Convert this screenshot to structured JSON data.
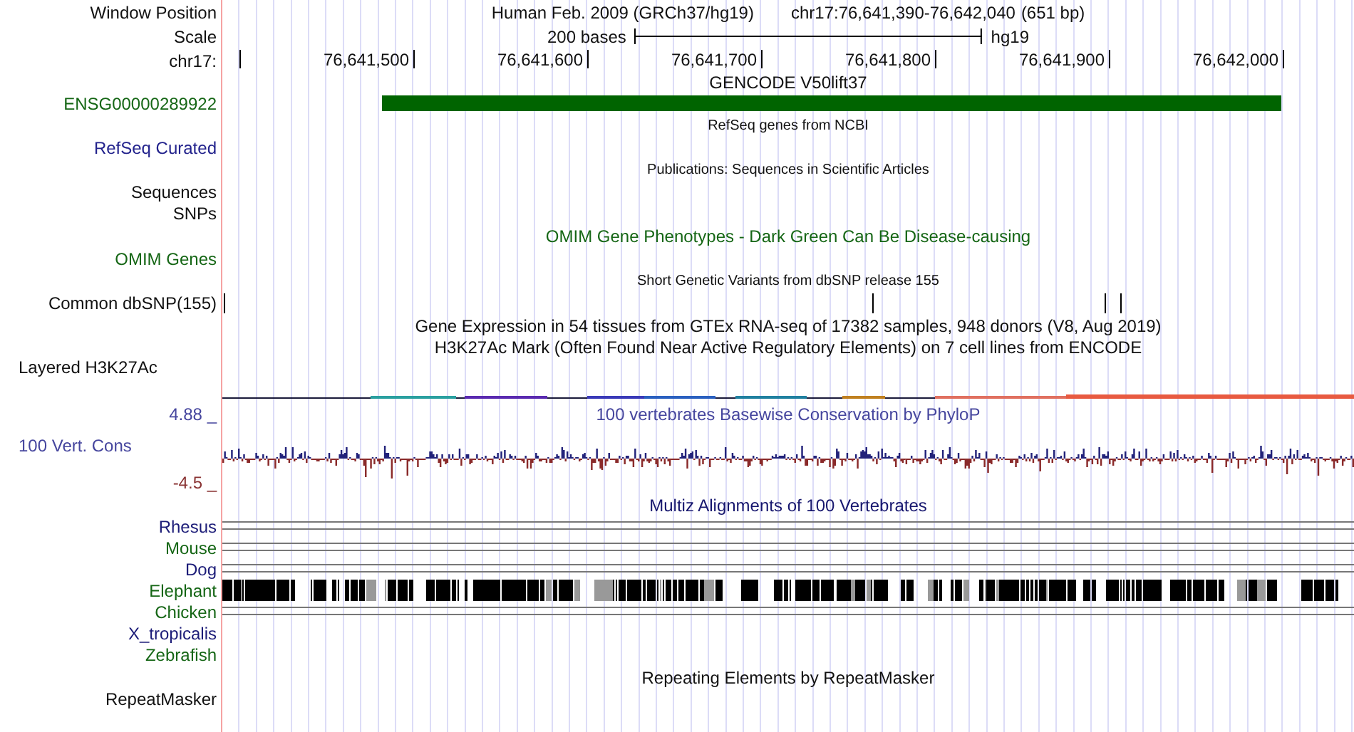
{
  "window_position": {
    "label": "Window Position",
    "assembly": "Human Feb. 2009 (GRCh37/hg19)",
    "position": "chr17:76,641,390-76,642,040",
    "size": "(651 bp)"
  },
  "scale": {
    "label": "Scale",
    "length": "200 bases",
    "assembly": "hg19"
  },
  "ruler": {
    "label": "chr17:",
    "ticks": [
      "76,641,500",
      "76,641,600",
      "76,641,700",
      "76,641,800",
      "76,641,900",
      "76,642,000"
    ]
  },
  "tracks": [
    {
      "kind": "gene",
      "title": "GENCODE V50lift37",
      "label": "ENSG00000289922"
    },
    {
      "kind": "refseq",
      "title": "RefSeq genes from NCBI",
      "label": "RefSeq Curated"
    },
    {
      "kind": "publications",
      "title": "Publications: Sequences in Scientific Articles",
      "labels": [
        "Sequences",
        "SNPs"
      ]
    },
    {
      "kind": "omim",
      "title": "OMIM Gene Phenotypes - Dark Green Can Be Disease-causing",
      "label": "OMIM Genes"
    },
    {
      "kind": "snp",
      "title": "Short Genetic Variants from dbSNP release 155",
      "label": "Common dbSNP(155)"
    },
    {
      "kind": "gtex",
      "title": "Gene Expression in 54 tissues from GTEx RNA-seq of 17382 samples, 948 donors (V8, Aug 2019)"
    },
    {
      "kind": "layered",
      "title": "H3K27Ac Mark (Often Found Near Active Regulatory Elements) on 7 cell lines from ENCODE",
      "label": "Layered H3K27Ac"
    },
    {
      "kind": "wiggle",
      "title": "100 vertebrates Basewise Conservation by PhyloP",
      "label": "100 Vert. Cons",
      "y_max": "4.88 _",
      "y_min": "-4.5 _"
    },
    {
      "kind": "alignment",
      "title": "Multiz Alignments of 100 Vertebrates",
      "species": [
        {
          "name": "Rhesus",
          "color": "#1c1c78",
          "kind": "lines"
        },
        {
          "name": "Mouse",
          "color": "#156615",
          "kind": "lines"
        },
        {
          "name": "Dog",
          "color": "#1c1c78",
          "kind": "lines"
        },
        {
          "name": "Elephant",
          "color": "#156615",
          "kind": "blocks"
        },
        {
          "name": "Chicken",
          "color": "#156615",
          "kind": "lines"
        },
        {
          "name": "X_tropicalis",
          "color": "#1c1c78",
          "kind": "none"
        },
        {
          "name": "Zebrafish",
          "color": "#156615",
          "kind": "none"
        }
      ]
    },
    {
      "kind": "repeats",
      "title": "Repeating Elements by RepeatMasker",
      "label": "RepeatMasker"
    }
  ]
}
